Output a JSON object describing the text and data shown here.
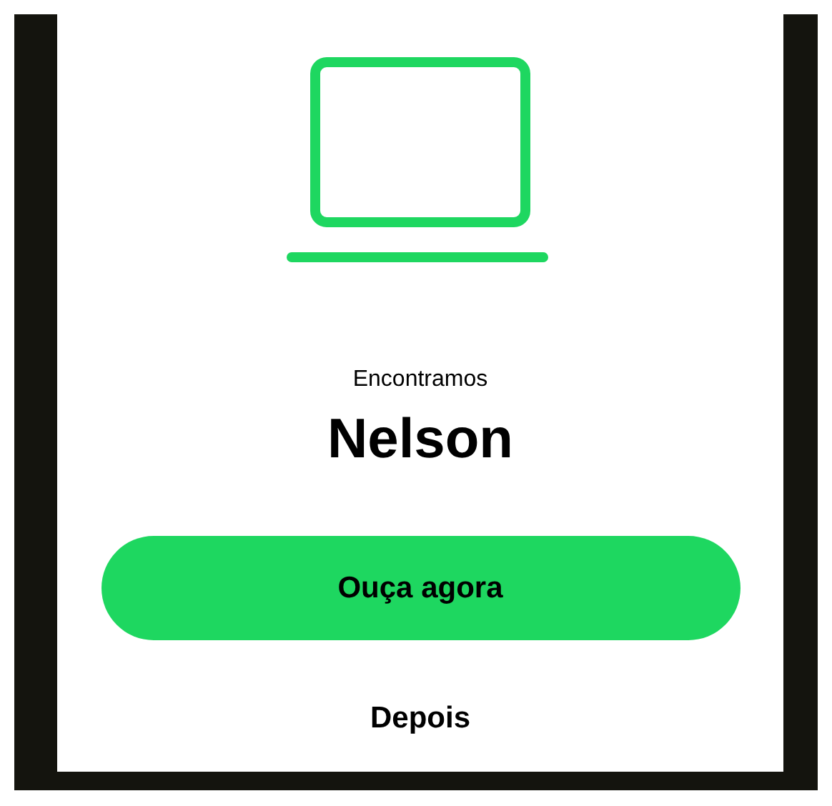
{
  "dialog": {
    "subtitle": "Encontramos",
    "title": "Nelson",
    "primary_button": "Ouça agora",
    "secondary_button": "Depois"
  }
}
